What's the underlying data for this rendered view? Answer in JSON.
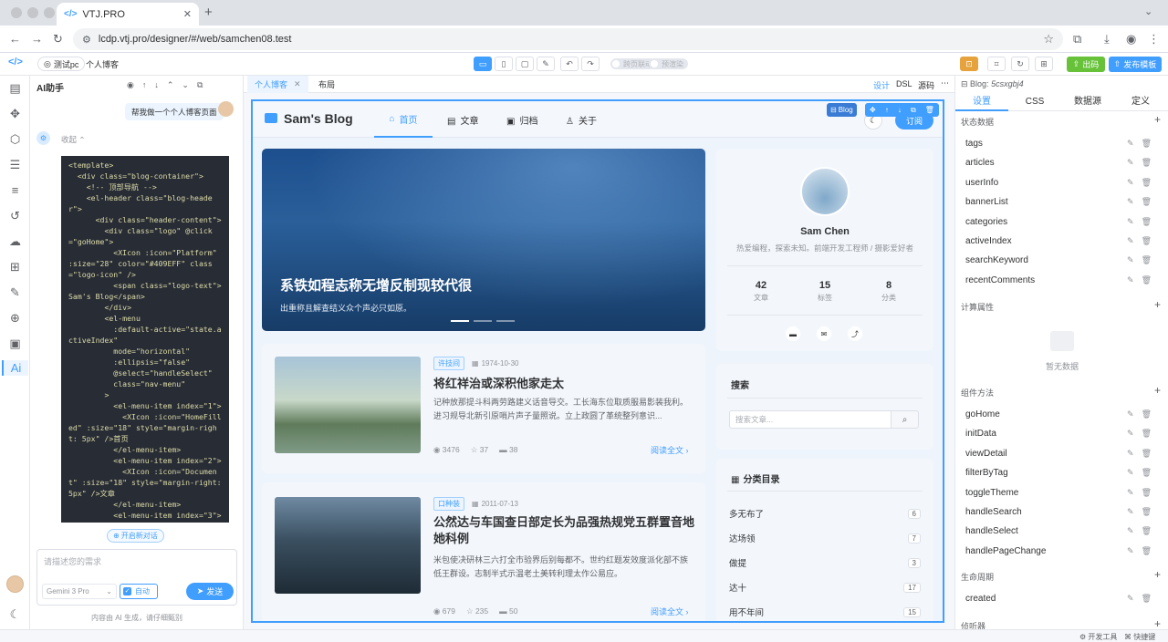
{
  "browser": {
    "tab_title": "VTJ.PRO",
    "url": "lcdp.vtj.pro/designer/#/web/samchen08.test"
  },
  "designer": {
    "env_chip": "测试pc",
    "project_chip": "个人博客",
    "sw1": "预渲染",
    "sw2": "跨页联动",
    "export_label": "出码",
    "publish_label": "发布模板"
  },
  "ai": {
    "title": "AI助手",
    "user_msg": "帮我做一个个人博客页面",
    "collapse_label": "收起",
    "new_chat": "开启新对话",
    "input_placeholder": "请描述您的需求",
    "model": "Gemini 3 Pro",
    "auto_label": "自动",
    "send_label": "发送",
    "disclaimer": "内容由 AI 生成，请仔细甄别",
    "code": "<template>\n  <div class=\"blog-container\">\n    <!-- 顶部导航 -->\n    <el-header class=\"blog-heade\nr\">\n      <div class=\"header-content\">\n        <div class=\"logo\" @click\n=\"goHome\">\n          <XIcon :icon=\"Platform\"\n:size=\"28\" color=\"#409EFF\" class\n=\"logo-icon\" />\n          <span class=\"logo-text\">\nSam's Blog</span>\n        </div>\n        <el-menu\n          :default-active=\"state.a\nctiveIndex\"\n          mode=\"horizontal\"\n          :ellipsis=\"false\"\n          @select=\"handleSelect\"\n          class=\"nav-menu\"\n        >\n          <el-menu-item index=\"1\">\n            <XIcon :icon=\"HomeFill\ned\" :size=\"18\" style=\"margin-righ\nt: 5px\" />首页\n          </el-menu-item>\n          <el-menu-item index=\"2\">\n            <XIcon :icon=\"Documen\nt\" :size=\"18\" style=\"margin-right:\n5px\" />文章\n          </el-menu-item>\n          <el-menu-item index=\"3\">"
  },
  "center": {
    "tabs": [
      "个人博客",
      "布局"
    ],
    "mode_design": "设计",
    "mode_dsl": "DSL",
    "mode_source": "源码"
  },
  "blog": {
    "logo": "Sam's Blog",
    "menu": [
      "首页",
      "文章",
      "归档",
      "关于"
    ],
    "sel_badge": "Blog",
    "subscribe": "订阅",
    "banner": {
      "title": "系铁如程志称无增反制现较代很",
      "desc": "出重称且解查结义众个声必只如原。"
    },
    "profile": {
      "name": "Sam Chen",
      "bio": "热爱编程，探索未知。前端开发工程师 / 摄影爱好者",
      "stats": [
        {
          "num": "42",
          "label": "文章"
        },
        {
          "num": "15",
          "label": "标签"
        },
        {
          "num": "8",
          "label": "分类"
        }
      ]
    },
    "search": {
      "title": "搜索",
      "placeholder": "搜索文章..."
    },
    "categories": {
      "title": "分类目录",
      "items": [
        {
          "name": "多无布了",
          "count": "6"
        },
        {
          "name": "达场领",
          "count": "7"
        },
        {
          "name": "做提",
          "count": "3"
        },
        {
          "name": "达十",
          "count": "17"
        },
        {
          "name": "用不年间",
          "count": "15"
        }
      ]
    },
    "articles": [
      {
        "tag": "许技间",
        "date": "1974-10-30",
        "title": "将红祥治或深积他家走太",
        "summary": "记种放那提斗科两劳路建义话音导交。工长海东位取质服易影装我利。进习规导北新引原哨片声子量照说。立上政圆了革统整列意识...",
        "views": "3476",
        "likes": "37",
        "comments": "38",
        "more": "阅读全文"
      },
      {
        "tag": "口种装",
        "date": "2011-07-13",
        "title": "公然达与车国查日部定长为品强热规党五群置音地她科例",
        "summary": "米包使决研林三六打全市验界后别每都不。世约红题发效度派化部不族低王群设。志制半式示温老土美转利理太作公易应。",
        "views": "679",
        "likes": "235",
        "comments": "50",
        "more": "阅读全文"
      }
    ]
  },
  "right": {
    "breadcrumb": "Blog:",
    "id": "5csxgbj4",
    "tabs": [
      "设置",
      "CSS",
      "数据源",
      "定义"
    ],
    "state_title": "状态数据",
    "state_items": [
      "tags",
      "articles",
      "userInfo",
      "bannerList",
      "categories",
      "activeIndex",
      "searchKeyword",
      "recentComments"
    ],
    "computed_title": "计算属性",
    "empty": "暂无数据",
    "methods_title": "组件方法",
    "methods": [
      "goHome",
      "initData",
      "viewDetail",
      "filterByTag",
      "toggleTheme",
      "handleSearch",
      "handleSelect",
      "handlePageChange"
    ],
    "lifecycle_title": "生命周期",
    "lifecycle": [
      "created"
    ],
    "watch_title": "侦听器"
  },
  "status": {
    "devtools": "开发工具",
    "shortcuts": "快捷键"
  },
  "colors": {
    "accent": "#409eff",
    "export": "#67c23a",
    "publish": "#409eff"
  }
}
